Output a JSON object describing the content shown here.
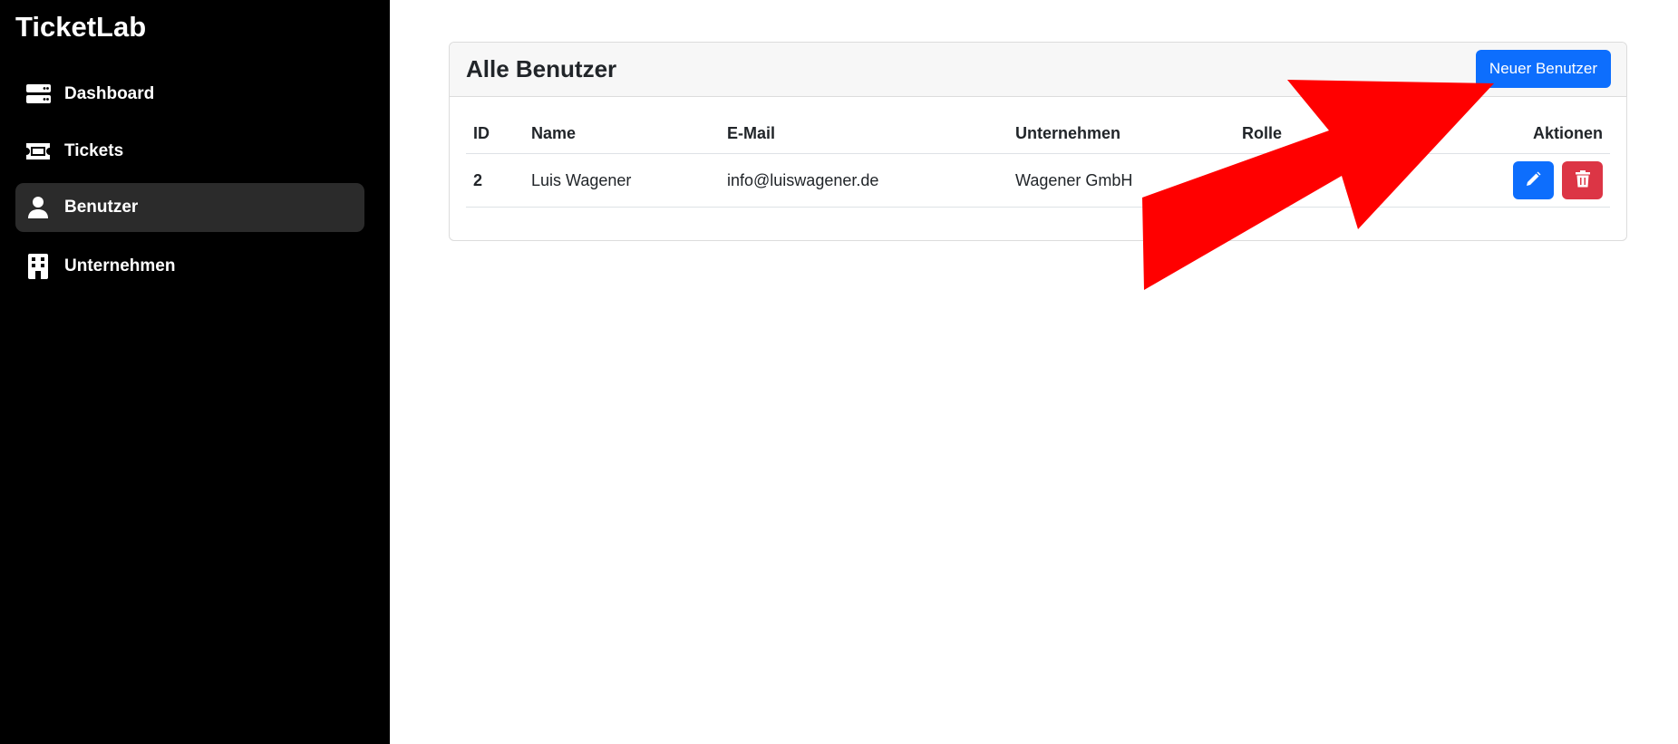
{
  "app": {
    "brand": "TicketLab"
  },
  "sidebar": {
    "items": [
      {
        "label": "Dashboard",
        "icon": "server-icon",
        "active": false
      },
      {
        "label": "Tickets",
        "icon": "ticket-icon",
        "active": false
      },
      {
        "label": "Benutzer",
        "icon": "user-icon",
        "active": true
      },
      {
        "label": "Unternehmen",
        "icon": "building-icon",
        "active": false
      }
    ]
  },
  "main": {
    "title": "Alle Benutzer",
    "new_button": "Neuer Benutzer",
    "table": {
      "headers": [
        "ID",
        "Name",
        "E-Mail",
        "Unternehmen",
        "Rolle",
        "Aktionen"
      ],
      "rows": [
        {
          "id": "2",
          "name": "Luis Wagener",
          "email": "info@luiswagener.de",
          "company": "Wagener GmbH",
          "role": ""
        }
      ]
    }
  },
  "colors": {
    "sidebar_bg": "#000000",
    "active_item": "#2b2b2b",
    "primary": "#0d6efd",
    "danger": "#dc3545",
    "annotation_arrow": "#ff0000"
  },
  "icons": {
    "edit": "pencil-icon",
    "delete": "trash-icon"
  }
}
